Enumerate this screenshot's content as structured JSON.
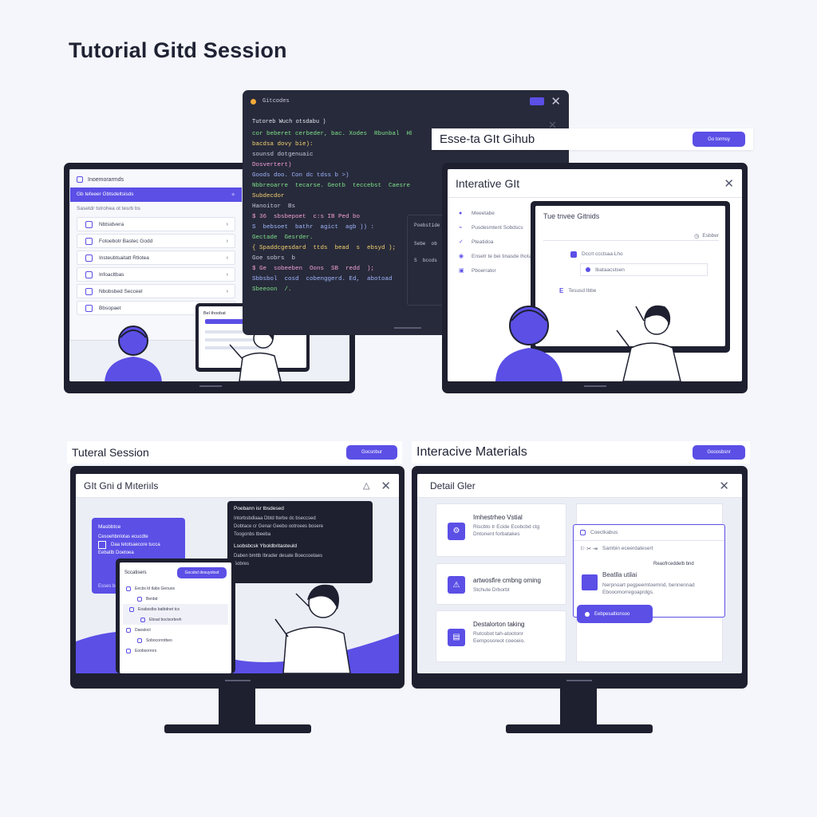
{
  "page": {
    "title": "Tutorial Gitd Session"
  },
  "colors": {
    "accent": "#5b4fe6",
    "dark": "#1e2030",
    "background": "#f4f6fb"
  },
  "code_window": {
    "title": "Gitcodes",
    "heading": "Tutoreb Wuch otsdabu )",
    "lines": [
      "cor beberet cerbeder, bac. Xodes  Rbunbal  Hbrbcr",
      "bacdsa dovy bie):",
      "sounsd dotgenuaic",
      "Dosvertert)",
      "Goods doo. Con dc tdss b >)",
      "Nbbreoarre  tecarse. Geotb  teccebst  Caesre",
      "Subdecdor",
      "Hanoitor  Bs",
      "$ 36  sbsbepoet  c:s IB Ped bo",
      "S  bebsoet  bathr  agict  agb )) :",
      "Gectade  Gesrder.",
      "{ Spaddcgesdard  ttds  bead  s  ebsyd );",
      "Goe sobrs  b",
      "$ Ge  sobeeben  Oons  SB  redd  );",
      "Sbbsbol  cosd  cobenggerd. Ed,  abotoad",
      "Sbeeoon  /."
    ],
    "side_label": "Poebstide",
    "side_items": [
      "Sebe  ob",
      "S  bcods"
    ]
  },
  "banner": {
    "label": "Esse-ta GIt Gihub",
    "button": "Go tormsy"
  },
  "left_monitor": {
    "header": "Inoemorarmds",
    "active_item": "Gb  tefeeer  Gbtsdeltsisds",
    "sub_label": "Sasetdr  tstrohea  ot  tesrb  bs",
    "items": [
      "Nbtsidvera",
      "Fotoebotr  Bastec  Godd",
      "Insteubtsaitatt  Rtlotea",
      "Infoacltbas",
      "Nbobsbed  Secceel",
      "Bbsopaet"
    ],
    "tablet": {
      "title": "Bel  thoobat"
    }
  },
  "right_monitor": {
    "title": "Interative GIt",
    "steps": [
      "Meeetabe",
      "Pusdesmtent  Sobdscs",
      "Pteatidoa",
      "Ensetr  te  bei  tinasde  lhotae",
      "Pboerrator"
    ],
    "inner": {
      "title": "Tue  tnvee  Gitnids",
      "tag": "Esbber",
      "item1": "Dccrt  ccctsaa  Lho",
      "item2": "Ibataacstsen",
      "item3": "Tesusd  Ibbe"
    }
  },
  "bottom_left": {
    "section_label": "Tuteral Session",
    "section_button": "Gocsnbur",
    "window_title": "GIt Gni d Mıteriıls",
    "purple_card": {
      "title": "Masbbtce",
      "lines": [
        "Cesoehbnlotas  ecucdte",
        "Daa  tetotsaecore  tucca",
        "Eebatlb  Doetoea"
      ],
      "footer": "Esses  bo"
    },
    "tooltip": {
      "title": "Poebann  isr  tbsdesed",
      "lines": [
        "Intorbsbdlaaa  Dbtd  tterbe  dc  bseccsed",
        "Dobtace  cr  Genar  Geebo  ootroees  bosere",
        "Toogonbs  tbeeba"
      ],
      "subtitle": "Lsobsbcsk  Yboldbritasteuld",
      "sub_lines": [
        "Daben  bmttb  Ibrader  desate  Boeccoetaes",
        "Sobres"
      ]
    },
    "tablet": {
      "title": "Sccatisers",
      "button": "Gocsbd  desuyobsd",
      "items": [
        "Eecbs  ld  tlabs  Geouos",
        "Benbd",
        "Eoabsstbs  batbdnet  tcs",
        "Eboat  boclsorbreh",
        "Daealoct",
        "Sobocorrotbeo",
        "Eoobsorrors"
      ]
    }
  },
  "bottom_right": {
    "section_label": "Interacive Materials",
    "section_button": "Gooosbsnr",
    "window_title": "Detail Gler",
    "cards": [
      {
        "title": "Imhestrheo  Vstial",
        "lines": [
          "Riscbto  tr  Ecide  Ecobcbd  ctg",
          "Dntonent  forbatakes"
        ]
      },
      {
        "title": "artwosfire  cmbng  oming",
        "lines": [
          "Stchute  Drborbt"
        ]
      },
      {
        "title": "Destalorton  taking",
        "lines": [
          "Rutosbot  tah-atootonr",
          "Eemposoreot  coeoeio."
        ]
      }
    ],
    "panel": {
      "header": "Coectkabus",
      "row": "Sambin  eceerdatesert",
      "title": "Beatlla  utilai",
      "aside": "Reaofrceddelb  bnd",
      "lines": [
        "Nerpnoart  pegpeemtoemnd,  bennennad",
        "Ebooomorregoaprdgs."
      ],
      "button": "Eebpesaltionsoo"
    }
  }
}
